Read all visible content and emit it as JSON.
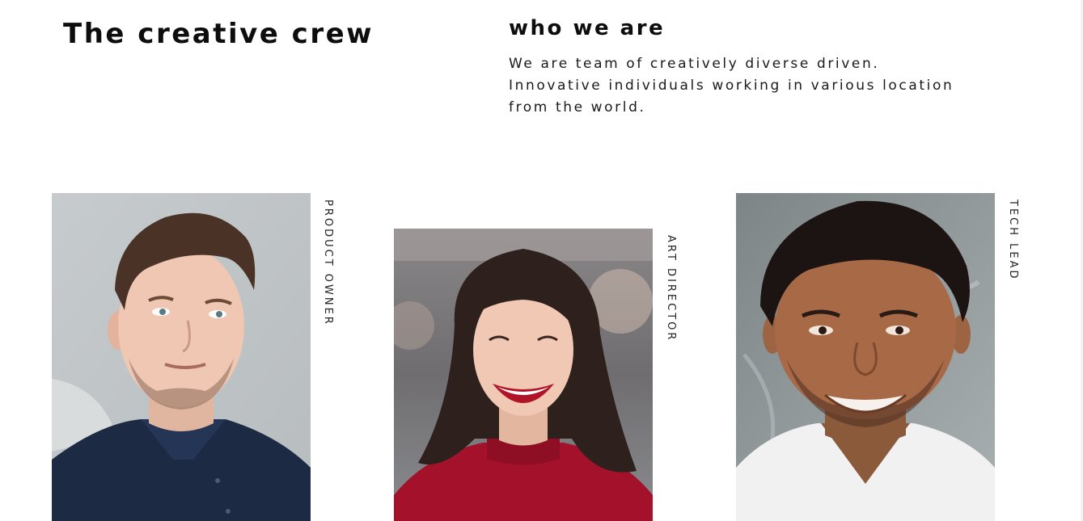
{
  "header": {
    "title": "The creative crew",
    "section_title": "who we are",
    "intro_lines": [
      "We are team of creatively diverse driven.",
      "Innovative individuals working in various location",
      "from the world."
    ]
  },
  "team": [
    {
      "role": "PRODUCT OWNER"
    },
    {
      "role": "ART DIRECTOR"
    },
    {
      "role": "TECH LEAD"
    }
  ],
  "colors": {
    "text": "#0d0d0d",
    "background": "#ffffff",
    "shirt_navy": "#1c2a44",
    "sweater_red": "#a3122a",
    "tee_white": "#f1f1f1"
  }
}
